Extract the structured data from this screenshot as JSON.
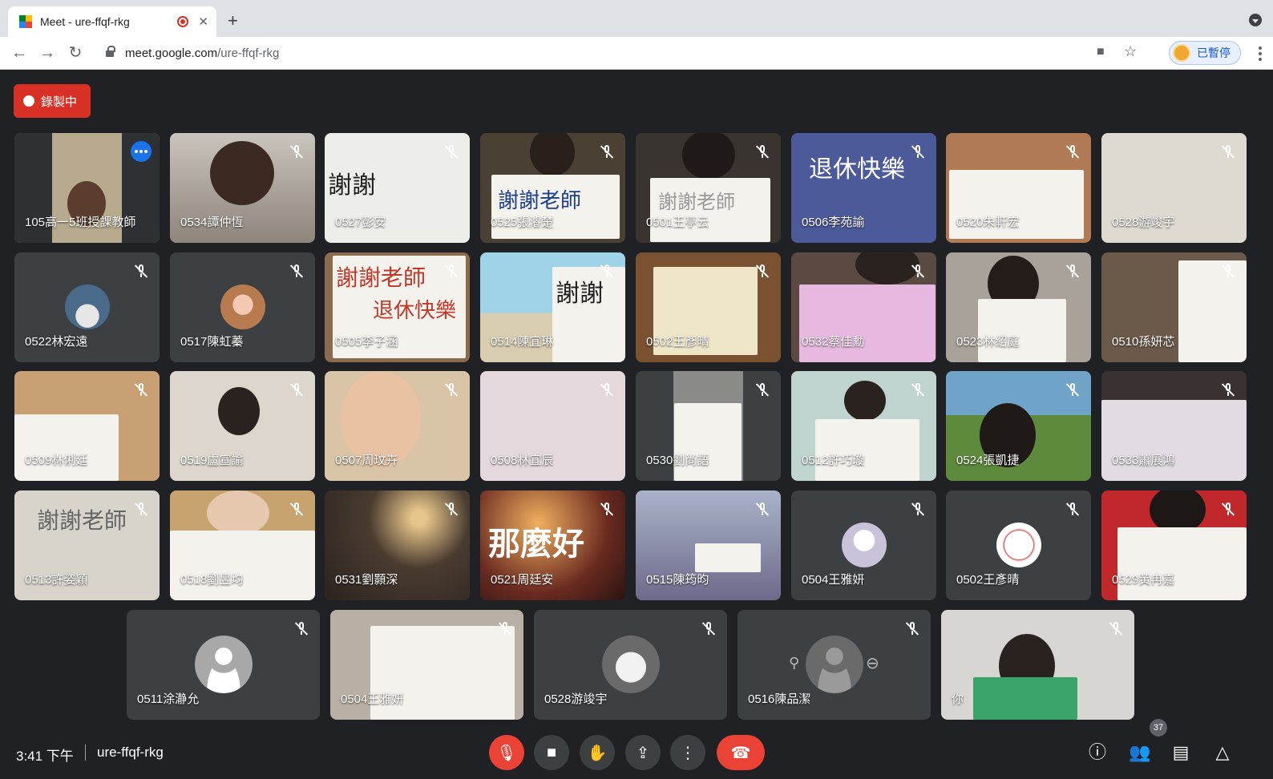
{
  "browser": {
    "tab_title": "Meet - ure-ffqf-rkg",
    "new_tab": "+",
    "close": "✕",
    "url_host": "meet.google.com",
    "url_path": "/ure-ffqf-rkg",
    "profile_label": "已暫停"
  },
  "meet": {
    "recording_label": "錄製中",
    "tiles": [
      {
        "name": "105高一5班授課教師"
      },
      {
        "name": "0534譚仲恆"
      },
      {
        "name": "0527彭安"
      },
      {
        "name": "0525張濬楚"
      },
      {
        "name": "0501王亭云"
      },
      {
        "name": "0506李苑諭"
      },
      {
        "name": "0520朱軒宏"
      },
      {
        "name": "0528游竣宇"
      },
      {
        "name": "0522林宏遠"
      },
      {
        "name": "0517陳虹蓁"
      },
      {
        "name": "0505李子涵"
      },
      {
        "name": "0514陳宜琳"
      },
      {
        "name": "0502王彥晴"
      },
      {
        "name": "0532蔡佳勳"
      },
      {
        "name": "0523林紹庭"
      },
      {
        "name": "0510孫妍芯"
      },
      {
        "name": "0509林俐廷"
      },
      {
        "name": "0519盧宣諭"
      },
      {
        "name": "0507周玟卉"
      },
      {
        "name": "0508林宜辰"
      },
      {
        "name": "0530劉尚語"
      },
      {
        "name": "0512許巧璇"
      },
      {
        "name": "0524張凱捷"
      },
      {
        "name": "0533蕭展鴻"
      },
      {
        "name": "0513許姿穎"
      },
      {
        "name": "0518劉昱均"
      },
      {
        "name": "0531劉顥深"
      },
      {
        "name": "0521周廷安"
      },
      {
        "name": "0515陳筠昀"
      },
      {
        "name": "0504王雅妍"
      },
      {
        "name": "0502王彥晴"
      },
      {
        "name": "0529黃冉嘉"
      },
      {
        "name": "0511涂瀞允"
      },
      {
        "name": "0504王雅妍"
      },
      {
        "name": "0528游竣宇"
      },
      {
        "name": "0516陳品潔"
      },
      {
        "name": "你"
      }
    ],
    "signs": {
      "s1": "謝謝老師",
      "s2": "退休快樂",
      "s3": "謝謝老師",
      "s4": "那麼好",
      "s5": "謝謝"
    }
  },
  "bottombar": {
    "time": "3:41 下午",
    "meeting_code": "ure-ffqf-rkg",
    "participants_count": "37"
  },
  "colors": {
    "background": "#202124",
    "tile": "#3c4043",
    "record_red": "#d93025",
    "selected_outline": "#8ab4f8"
  }
}
